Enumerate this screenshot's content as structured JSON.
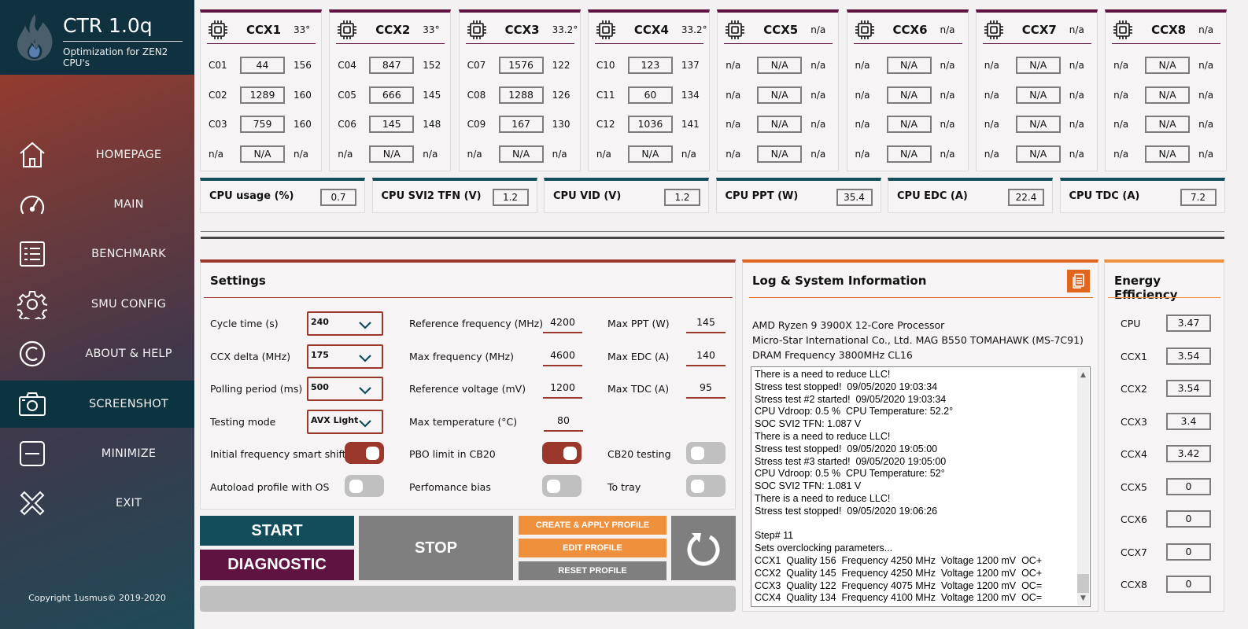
{
  "app": {
    "title": "CTR 1.0q",
    "subtitle": "Optimization for ZEN2 CPU's",
    "copyright": "Copyright 1usmus© 2019-2020"
  },
  "sidebar": {
    "items": [
      {
        "label": "HOMEPAGE",
        "icon": "home-icon",
        "active": false
      },
      {
        "label": "MAIN",
        "icon": "speedometer-icon",
        "active": false
      },
      {
        "label": "BENCHMARK",
        "icon": "list-icon",
        "active": false
      },
      {
        "label": "SMU CONFIG",
        "icon": "gear-icon",
        "active": false
      },
      {
        "label": "ABOUT & HELP",
        "icon": "copyright-icon",
        "active": false
      },
      {
        "label": "SCREENSHOT",
        "icon": "camera-icon",
        "active": true
      },
      {
        "label": "MINIMIZE",
        "icon": "minimize-icon",
        "active": false
      },
      {
        "label": "EXIT",
        "icon": "close-icon",
        "active": false
      }
    ]
  },
  "ccx": [
    {
      "name": "CCX1",
      "temp": "33°",
      "cores": [
        {
          "id": "C01",
          "value": "44",
          "quality": "156"
        },
        {
          "id": "C02",
          "value": "1289",
          "quality": "160"
        },
        {
          "id": "C03",
          "value": "759",
          "quality": "160"
        },
        {
          "id": "n/a",
          "value": "N/A",
          "quality": "n/a"
        }
      ]
    },
    {
      "name": "CCX2",
      "temp": "33°",
      "cores": [
        {
          "id": "C04",
          "value": "847",
          "quality": "152"
        },
        {
          "id": "C05",
          "value": "666",
          "quality": "145"
        },
        {
          "id": "C06",
          "value": "145",
          "quality": "148"
        },
        {
          "id": "n/a",
          "value": "N/A",
          "quality": "n/a"
        }
      ]
    },
    {
      "name": "CCX3",
      "temp": "33.2°",
      "cores": [
        {
          "id": "C07",
          "value": "1576",
          "quality": "122"
        },
        {
          "id": "C08",
          "value": "1288",
          "quality": "126"
        },
        {
          "id": "C09",
          "value": "167",
          "quality": "130"
        },
        {
          "id": "n/a",
          "value": "N/A",
          "quality": "n/a"
        }
      ]
    },
    {
      "name": "CCX4",
      "temp": "33.2°",
      "cores": [
        {
          "id": "C10",
          "value": "123",
          "quality": "137"
        },
        {
          "id": "C11",
          "value": "60",
          "quality": "134"
        },
        {
          "id": "C12",
          "value": "1036",
          "quality": "141"
        },
        {
          "id": "n/a",
          "value": "N/A",
          "quality": "n/a"
        }
      ]
    },
    {
      "name": "CCX5",
      "temp": "n/a",
      "cores": [
        {
          "id": "n/a",
          "value": "N/A",
          "quality": "n/a"
        },
        {
          "id": "n/a",
          "value": "N/A",
          "quality": "n/a"
        },
        {
          "id": "n/a",
          "value": "N/A",
          "quality": "n/a"
        },
        {
          "id": "n/a",
          "value": "N/A",
          "quality": "n/a"
        }
      ]
    },
    {
      "name": "CCX6",
      "temp": "n/a",
      "cores": [
        {
          "id": "n/a",
          "value": "N/A",
          "quality": "n/a"
        },
        {
          "id": "n/a",
          "value": "N/A",
          "quality": "n/a"
        },
        {
          "id": "n/a",
          "value": "N/A",
          "quality": "n/a"
        },
        {
          "id": "n/a",
          "value": "N/A",
          "quality": "n/a"
        }
      ]
    },
    {
      "name": "CCX7",
      "temp": "n/a",
      "cores": [
        {
          "id": "n/a",
          "value": "N/A",
          "quality": "n/a"
        },
        {
          "id": "n/a",
          "value": "N/A",
          "quality": "n/a"
        },
        {
          "id": "n/a",
          "value": "N/A",
          "quality": "n/a"
        },
        {
          "id": "n/a",
          "value": "N/A",
          "quality": "n/a"
        }
      ]
    },
    {
      "name": "CCX8",
      "temp": "n/a",
      "cores": [
        {
          "id": "n/a",
          "value": "N/A",
          "quality": "n/a"
        },
        {
          "id": "n/a",
          "value": "N/A",
          "quality": "n/a"
        },
        {
          "id": "n/a",
          "value": "N/A",
          "quality": "n/a"
        },
        {
          "id": "n/a",
          "value": "N/A",
          "quality": "n/a"
        }
      ]
    }
  ],
  "metrics": [
    {
      "label": "CPU usage (%)",
      "value": "0.7"
    },
    {
      "label": "CPU SVI2 TFN (V)",
      "value": "1.2"
    },
    {
      "label": "CPU VID (V)",
      "value": "1.2"
    },
    {
      "label": "CPU PPT (W)",
      "value": "35.4"
    },
    {
      "label": "CPU EDC (A)",
      "value": "22.4"
    },
    {
      "label": "CPU TDC (A)",
      "value": "7.2"
    }
  ],
  "settings": {
    "title": "Settings",
    "dropdowns": [
      {
        "label": "Cycle time (s)",
        "value": "240"
      },
      {
        "label": "CCX delta (MHz)",
        "value": "175"
      },
      {
        "label": "Polling period (ms)",
        "value": "500"
      },
      {
        "label": "Testing mode",
        "value": "AVX Light"
      }
    ],
    "fields_mid": [
      {
        "label": "Reference frequency (MHz)",
        "value": "4200"
      },
      {
        "label": "Max frequency (MHz)",
        "value": "4600"
      },
      {
        "label": "Reference voltage (mV)",
        "value": "1200"
      },
      {
        "label": "Max temperature (°C)",
        "value": "80"
      }
    ],
    "fields_right": [
      {
        "label": "Max PPT (W)",
        "value": "145"
      },
      {
        "label": "Max EDC (A)",
        "value": "140"
      },
      {
        "label": "Max TDC (A)",
        "value": "95"
      }
    ],
    "toggles": [
      {
        "label": "Initial frequency smart shift",
        "on": true
      },
      {
        "label": "PBO limit in CB20",
        "on": true
      },
      {
        "label": "CB20 testing",
        "on": false
      },
      {
        "label": "Autoload profile with OS",
        "on": false
      },
      {
        "label": "Perfomance bias",
        "on": false
      },
      {
        "label": "To tray",
        "on": false
      }
    ]
  },
  "log": {
    "title": "Log & System Information",
    "system": [
      "AMD Ryzen 9 3900X 12-Core Processor",
      "Micro-Star International Co., Ltd. MAG B550 TOMAHAWK (MS-7C91)",
      "DRAM Frequency 3800MHz CL16"
    ],
    "lines": [
      "There is a need to reduce LLC!",
      "Stress test stopped!  09/05/2020 19:03:34",
      "Stress test #2 started!  09/05/2020 19:03:34",
      "CPU Vdroop: 0.5 %  CPU Temperature: 52.2°",
      "SOC SVI2 TFN: 1.087 V",
      "There is a need to reduce LLC!",
      "Stress test stopped!  09/05/2020 19:05:00",
      "Stress test #3 started!  09/05/2020 19:05:00",
      "CPU Vdroop: 0.5 %  CPU Temperature: 52°",
      "SOC SVI2 TFN: 1.081 V",
      "There is a need to reduce LLC!",
      "Stress test stopped!  09/05/2020 19:06:26",
      "",
      "Step# 11",
      "Sets overclocking parameters...",
      "CCX1  Quality 156  Frequency 4250 MHz  Voltage 1200 mV  OC+",
      "CCX2  Quality 145  Frequency 4250 MHz  Voltage 1200 mV  OC+",
      "CCX3  Quality 122  Frequency 4075 MHz  Voltage 1200 mV  OC=",
      "CCX4  Quality 134  Frequency 4100 MHz  Voltage 1200 mV  OC="
    ],
    "scroll_position": 0.95
  },
  "energy": {
    "title": "Energy Efficiency",
    "rows": [
      {
        "label": "CPU",
        "value": "3.47"
      },
      {
        "label": "CCX1",
        "value": "3.54"
      },
      {
        "label": "CCX2",
        "value": "3.54"
      },
      {
        "label": "CCX3",
        "value": "3.4"
      },
      {
        "label": "CCX4",
        "value": "3.42"
      },
      {
        "label": "CCX5",
        "value": "0"
      },
      {
        "label": "CCX6",
        "value": "0"
      },
      {
        "label": "CCX7",
        "value": "0"
      },
      {
        "label": "CCX8",
        "value": "0"
      }
    ]
  },
  "actions": {
    "start": "START",
    "diagnostic": "DIAGNOSTIC",
    "stop": "STOP",
    "create_apply": "CREATE & APPLY PROFILE",
    "edit": "EDIT PROFILE",
    "reset": "RESET PROFILE",
    "refresh_icon": "refresh-icon",
    "progress": 0
  },
  "colors": {
    "brand_dark": "#0f3140",
    "teal": "#134d5c",
    "plum": "#5e1340",
    "rust": "#9b382c",
    "orange": "#ef903d",
    "orange_dark": "#e0661d",
    "gray_button": "#7f7f7f"
  }
}
